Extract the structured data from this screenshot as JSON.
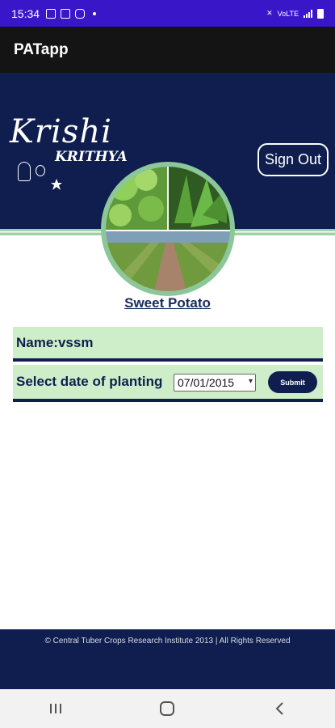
{
  "status_bar": {
    "time": "15:34",
    "network_text": "VoLTE",
    "icons": [
      "image-icon",
      "app-icon",
      "instagram-icon",
      "dot-icon",
      "mute-icon",
      "signal-icon",
      "battery-icon"
    ]
  },
  "app_bar": {
    "title": "PATapp"
  },
  "header": {
    "logo_line1": "Krishi",
    "logo_line2": "KRITHYA",
    "signout_label": "Sign Out",
    "photo": "crop-collage"
  },
  "crop": {
    "name": "Sweet Potato"
  },
  "form": {
    "name_label": "Name:vssm",
    "date_label": "Select date of planting",
    "date_value": "07/01/2015",
    "submit_label": "Submit"
  },
  "footer": {
    "copyright": "© Central Tuber Crops Research Institute 2013 | All Rights Reserved"
  },
  "nav": {
    "icons": [
      "recents-icon",
      "home-icon",
      "back-icon"
    ]
  },
  "colors": {
    "primary": "#0f1e4e",
    "accent_green": "#8cc79a",
    "panel": "#cdeec8",
    "status": "#3a16c9"
  }
}
